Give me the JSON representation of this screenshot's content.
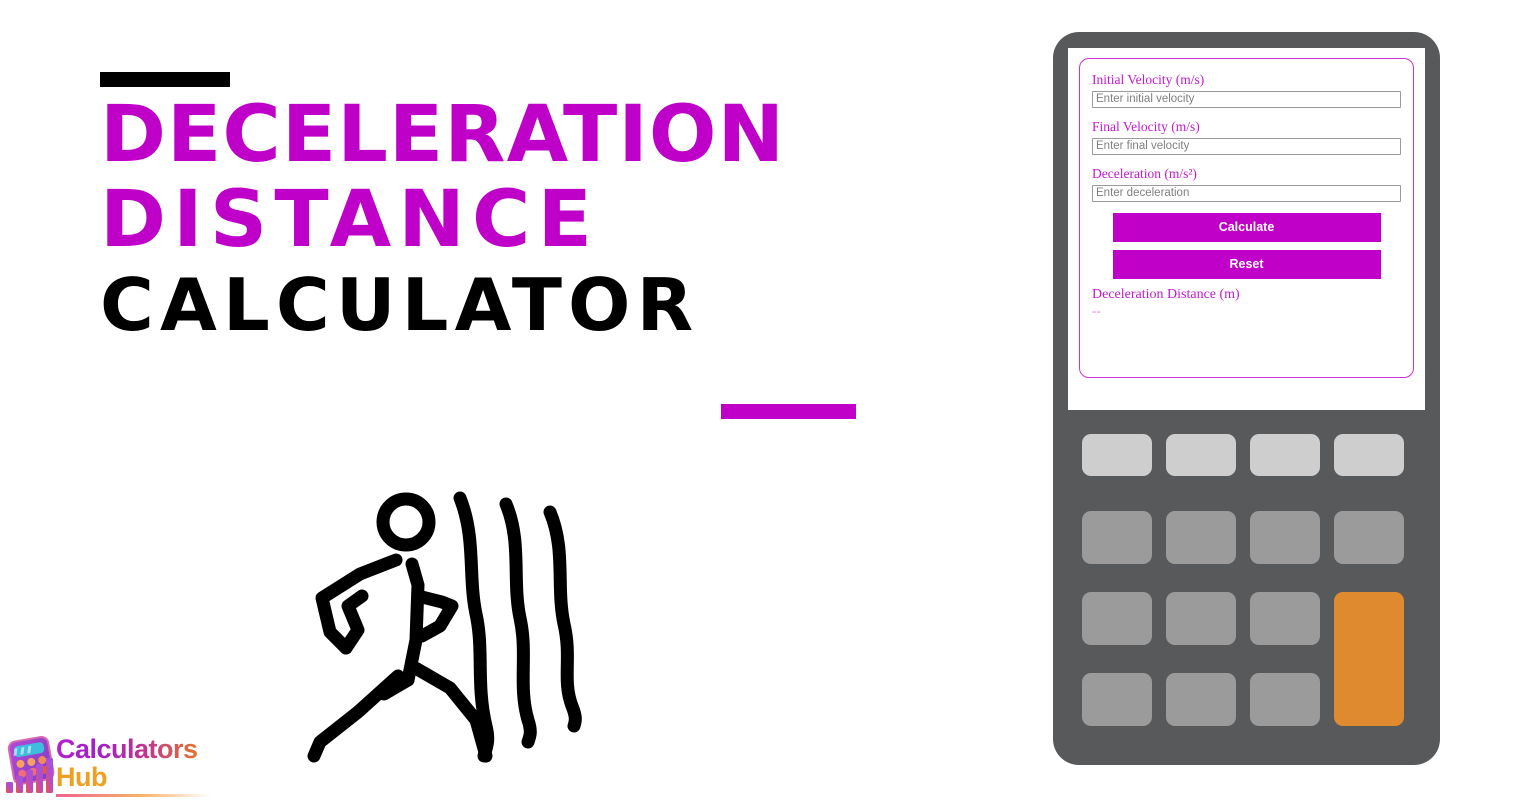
{
  "page": {
    "title_lines": [
      "DECELERATION",
      "DISTANCE",
      "CALCULATOR"
    ],
    "accent_color": "#c000c8",
    "black_color": "#000000"
  },
  "hero": {
    "icon_name": "running-person-motion-icon",
    "rule_top_color": "#000000",
    "rule_bottom_color": "#c000c8"
  },
  "logo": {
    "word_1": "Calculators",
    "word_2": "Hub",
    "mark_name": "calculator-bar-chart-logo-icon",
    "word_1_color": "#a020c8",
    "word_2_color": "#eda024"
  },
  "calculator": {
    "fields": [
      {
        "label": "Initial Velocity (m/s)",
        "placeholder": "Enter initial velocity",
        "value": ""
      },
      {
        "label": "Final Velocity (m/s)",
        "placeholder": "Enter final velocity",
        "value": ""
      },
      {
        "label": "Deceleration (m/s²)",
        "placeholder": "Enter deceleration",
        "value": ""
      }
    ],
    "buttons": {
      "calculate": "Calculate",
      "reset": "Reset"
    },
    "result": {
      "label": "Deceleration Distance (m)",
      "value": "--"
    },
    "colors": {
      "card_border": "#d030d8",
      "label": "#c41ad0",
      "button": "#c000c8",
      "button_text": "#ffffff",
      "result_value": "#dd7de0"
    }
  },
  "keypad": {
    "frame_color": "#58595b",
    "key_light_color": "#cecece",
    "key_color": "#9b9b9b",
    "key_accent_color": "#e08a30",
    "rows": 4,
    "columns": 4
  }
}
